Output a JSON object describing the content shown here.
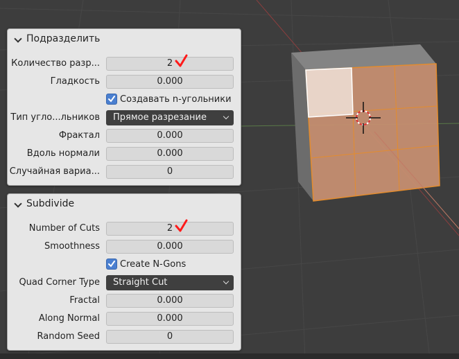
{
  "panels": {
    "ru": {
      "title": "Подразделить",
      "cuts_label": "Количество разр...",
      "cuts_value": "2",
      "smoothness_label": "Гладкость",
      "smoothness_value": "0.000",
      "ngons_label": "Создавать n-угольники",
      "quad_label": "Тип угло...льников",
      "quad_value": "Прямое разрезание",
      "fractal_label": "Фрактал",
      "fractal_value": "0.000",
      "along_normal_label": "Вдоль нормали",
      "along_normal_value": "0.000",
      "seed_label": "Случайная вариа...",
      "seed_value": "0"
    },
    "en": {
      "title": "Subdivide",
      "cuts_label": "Number of Cuts",
      "cuts_value": "2",
      "smoothness_label": "Smoothness",
      "smoothness_value": "0.000",
      "ngons_label": "Create N-Gons",
      "quad_label": "Quad Corner Type",
      "quad_value": "Straight Cut",
      "fractal_label": "Fractal",
      "fractal_value": "0.000",
      "along_normal_label": "Along Normal",
      "along_normal_value": "0.000",
      "seed_label": "Random Seed",
      "seed_value": "0"
    }
  },
  "colors": {
    "background": "#3d3d3d",
    "panel": "#e6e6e6",
    "field": "#d9d9d9",
    "dropdown": "#3f3f3f",
    "checkbox": "#4a7fd0",
    "selected_face": "#c99072",
    "edge_orange": "#e48c2d",
    "annotation_red": "#ff1a1a"
  }
}
